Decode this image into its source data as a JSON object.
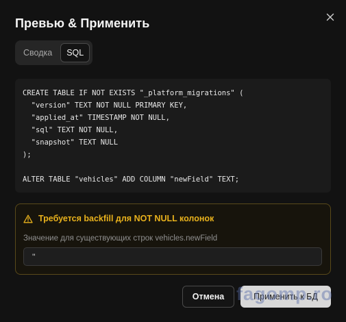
{
  "dialog": {
    "title": "Превью & Применить",
    "close_icon": "close-icon"
  },
  "tabs": [
    {
      "label": "Сводка",
      "active": false
    },
    {
      "label": "SQL",
      "active": true
    }
  ],
  "sql": {
    "code": "CREATE TABLE IF NOT EXISTS \"_platform_migrations\" (\n  \"version\" TEXT NOT NULL PRIMARY KEY,\n  \"applied_at\" TIMESTAMP NOT NULL,\n  \"sql\" TEXT NOT NULL,\n  \"snapshot\" TEXT NULL\n);\n\nALTER TABLE \"vehicles\" ADD COLUMN \"newField\" TEXT;"
  },
  "warning": {
    "icon": "warning-triangle-icon",
    "title": "Требуется backfill для NOT NULL колонок",
    "field_label": "Значение для существующих строк vehicles.newField",
    "field_value": "''"
  },
  "buttons": {
    "cancel_label": "Отмена",
    "apply_label": "Применить к БД"
  },
  "watermark": "fagomp.ro",
  "colors": {
    "background": "#121212",
    "warning_accent": "#e8b11c",
    "warning_border": "#5a4a1a",
    "primary_button": "#d8d8d8"
  }
}
